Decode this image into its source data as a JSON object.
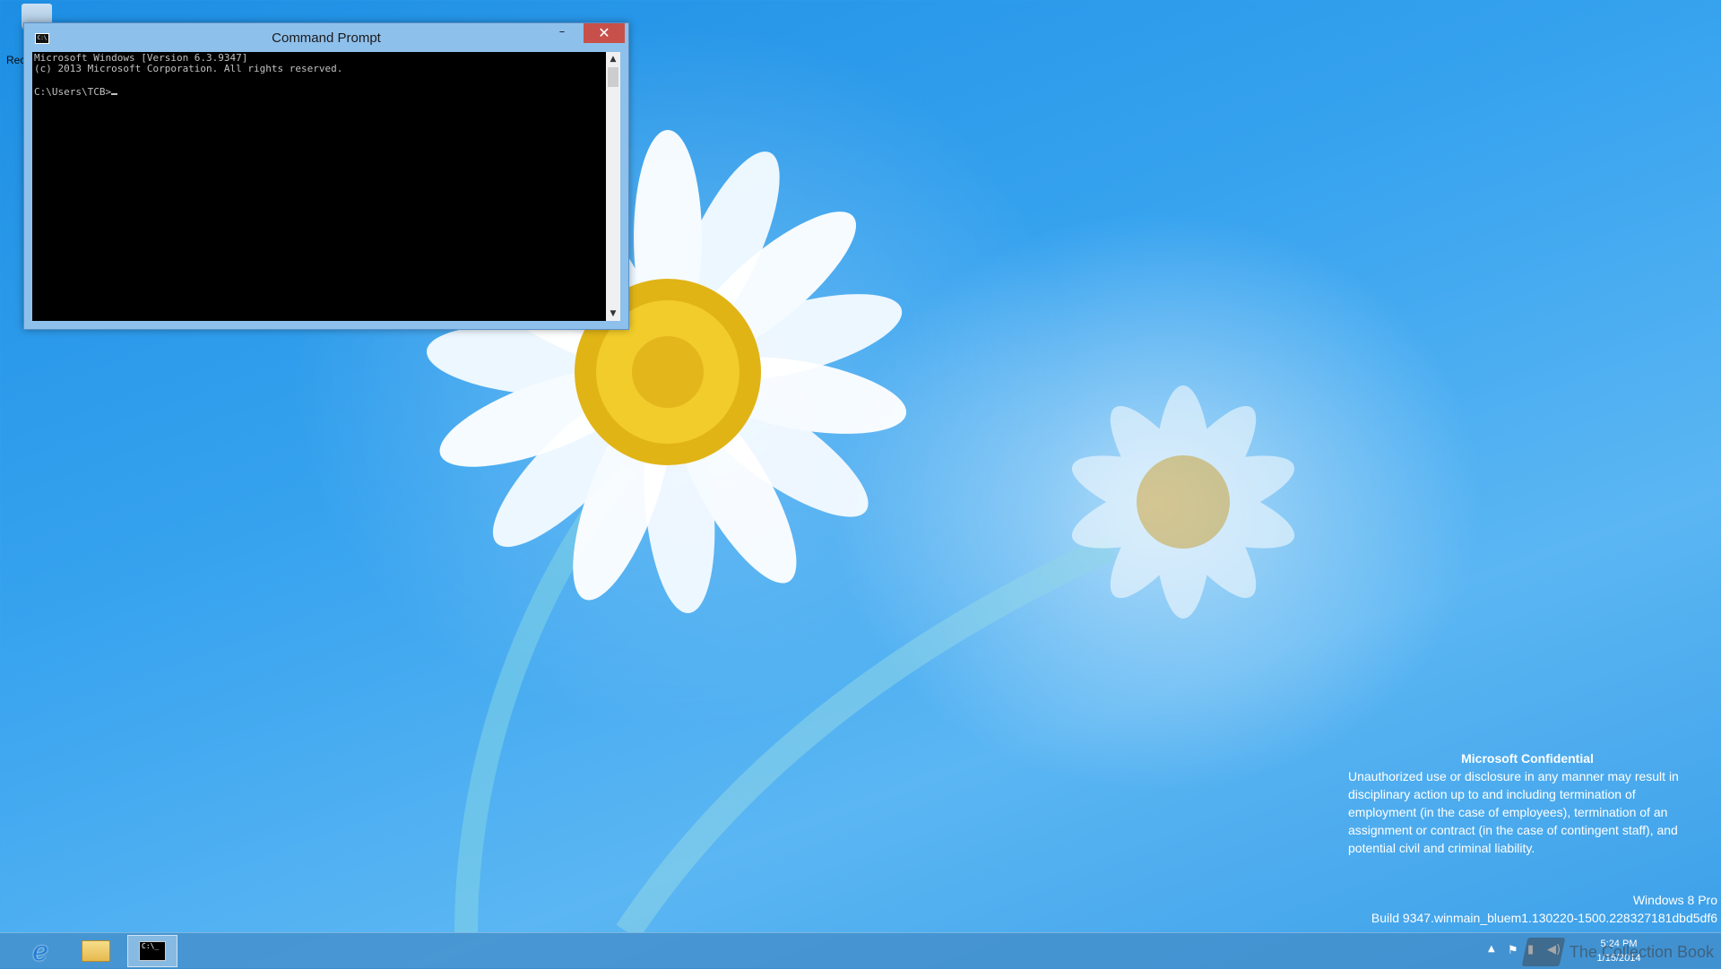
{
  "desktop": {
    "icons": [
      {
        "name": "recycle-bin",
        "label": "Rec"
      }
    ]
  },
  "cmd_window": {
    "title": "Command Prompt",
    "lines": [
      "Microsoft Windows [Version 6.3.9347]",
      "(c) 2013 Microsoft Corporation. All rights reserved.",
      "",
      "C:\\Users\\TCB>"
    ],
    "buttons": {
      "minimize": "–",
      "maximize": "□",
      "close": "✕"
    },
    "scroll_up": "▲",
    "scroll_down": "▼"
  },
  "confidential": {
    "title": "Microsoft Confidential",
    "body": "Unauthorized use or disclosure in any manner may result in disciplinary action up to and including termination of employment (in the case of employees), termination of an assignment or contract (in the case of contingent staff), and potential civil and criminal liability."
  },
  "build": {
    "edition": "Windows 8 Pro",
    "build_string": "Build 9347.winmain_bluem1.130220-1500.228327181dbd5df6"
  },
  "taskbar": {
    "pinned": [
      {
        "name": "internet-explorer",
        "icon": "ie-icon",
        "glyph": "e"
      },
      {
        "name": "file-explorer",
        "icon": "folder-icon"
      },
      {
        "name": "command-prompt",
        "icon": "cmd-icon",
        "glyph": "C:\\_",
        "active": true
      }
    ],
    "tray": {
      "overflow": "▲",
      "flag": "⚑",
      "network": "▮",
      "volume": "◀)"
    },
    "clock": {
      "time": "5:24 PM",
      "date": "1/15/2014"
    }
  },
  "watermark": {
    "site_text": "The Collection Book"
  },
  "colors": {
    "desktop_blue": "#37a3ef",
    "titlebar": "#8ec0ec",
    "close_red": "#c7504a",
    "console_bg": "#000000",
    "console_fg": "#c0c0c0"
  }
}
